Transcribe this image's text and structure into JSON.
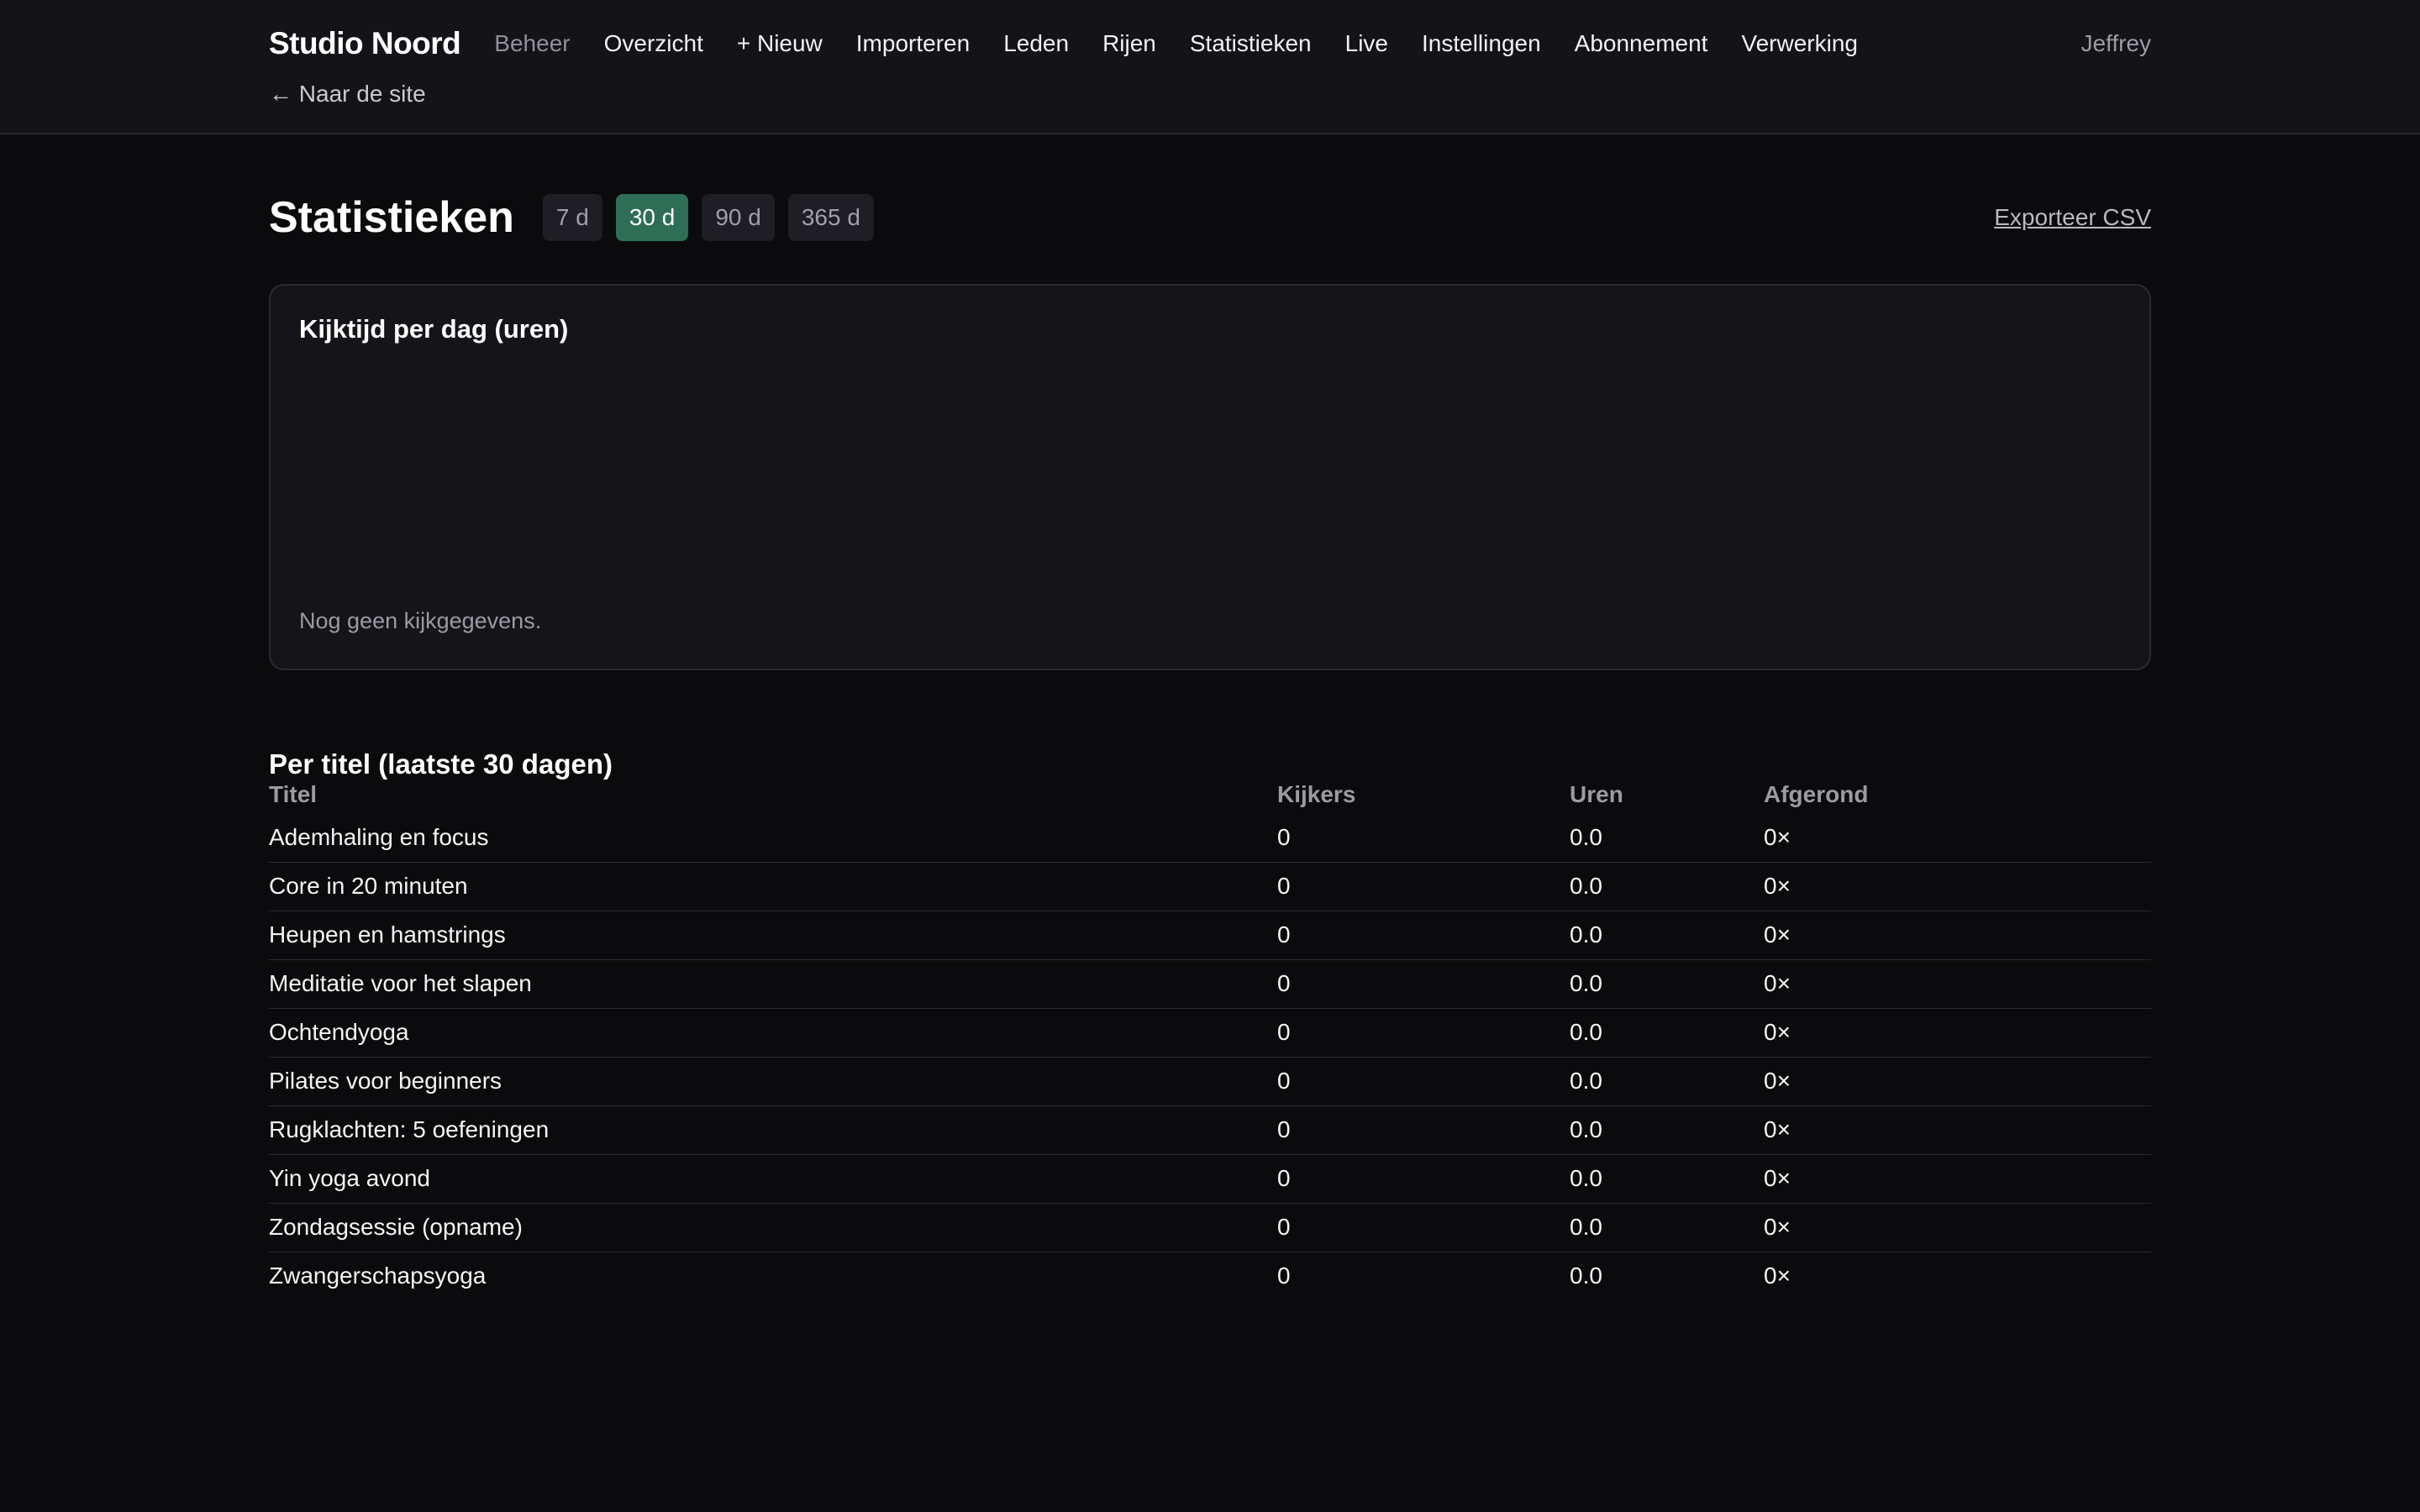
{
  "header": {
    "brand": "Studio Noord",
    "nav_muted": "Beheer",
    "nav_items": [
      "Overzicht",
      "+ Nieuw",
      "Importeren",
      "Leden",
      "Rijen",
      "Statistieken",
      "Live",
      "Instellingen",
      "Abonnement",
      "Verwerking"
    ],
    "user": "Jeffrey",
    "back_link": "← Naar de site"
  },
  "page": {
    "title": "Statistieken",
    "ranges": [
      {
        "label": "7 d",
        "active": false
      },
      {
        "label": "30 d",
        "active": true
      },
      {
        "label": "90 d",
        "active": false
      },
      {
        "label": "365 d",
        "active": false
      }
    ],
    "export_label": "Exporteer CSV"
  },
  "chart": {
    "title": "Kijktijd per dag (uren)",
    "empty_text": "Nog geen kijkgegevens."
  },
  "chart_data": {
    "type": "bar",
    "title": "Kijktijd per dag (uren)",
    "categories": [],
    "values": []
  },
  "table": {
    "section_title": "Per titel (laatste 30 dagen)",
    "columns": [
      "Titel",
      "Kijkers",
      "Uren",
      "Afgerond"
    ],
    "rows": [
      [
        "Ademhaling en focus",
        "0",
        "0.0",
        "0×"
      ],
      [
        "Core in 20 minuten",
        "0",
        "0.0",
        "0×"
      ],
      [
        "Heupen en hamstrings",
        "0",
        "0.0",
        "0×"
      ],
      [
        "Meditatie voor het slapen",
        "0",
        "0.0",
        "0×"
      ],
      [
        "Ochtendyoga",
        "0",
        "0.0",
        "0×"
      ],
      [
        "Pilates voor beginners",
        "0",
        "0.0",
        "0×"
      ],
      [
        "Rugklachten: 5 oefeningen",
        "0",
        "0.0",
        "0×"
      ],
      [
        "Yin yoga avond",
        "0",
        "0.0",
        "0×"
      ],
      [
        "Zondagsessie (opname)",
        "0",
        "0.0",
        "0×"
      ],
      [
        "Zwangerschapsyoga",
        "0",
        "0.0",
        "0×"
      ]
    ]
  },
  "colors": {
    "background": "#0b0b0d",
    "header_bg": "#131318",
    "card_bg": "#141419",
    "accent": "#2e6e56",
    "muted_text": "#9a9ba3"
  }
}
